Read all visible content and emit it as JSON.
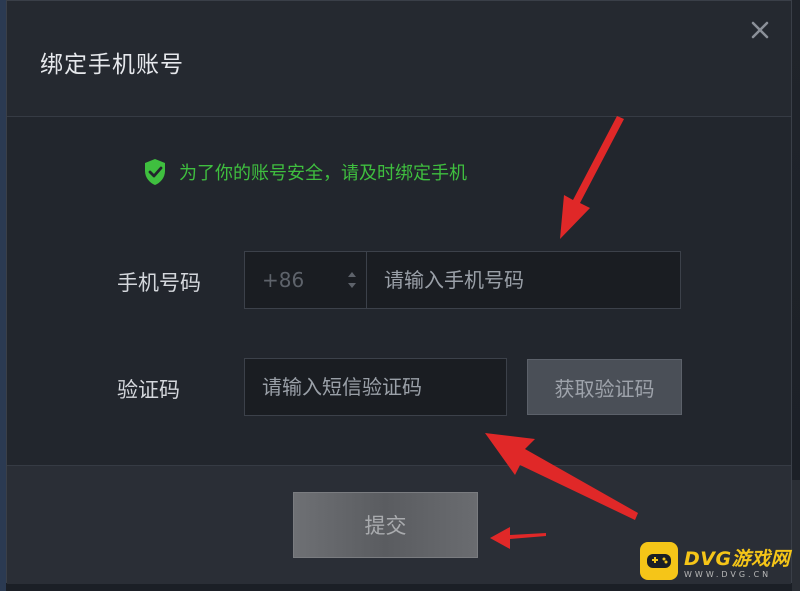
{
  "dialog": {
    "title": "绑定手机账号",
    "notice": "为了你的账号安全，请及时绑定手机",
    "phone": {
      "label": "手机号码",
      "country_code": "+86",
      "placeholder": "请输入手机号码"
    },
    "verification": {
      "label": "验证码",
      "placeholder": "请输入短信验证码",
      "get_code_label": "获取验证码"
    },
    "submit_label": "提交"
  },
  "watermark": {
    "name": "DVG游戏网",
    "url": "WWW.DVG.CN"
  },
  "icons": {
    "close": "close-icon",
    "shield": "shield-check-icon",
    "spinner": "spinner-arrows-icon"
  },
  "colors": {
    "notice_green": "#3fbf3f",
    "arrow_red": "#e02828",
    "watermark_yellow": "#f5c518"
  }
}
